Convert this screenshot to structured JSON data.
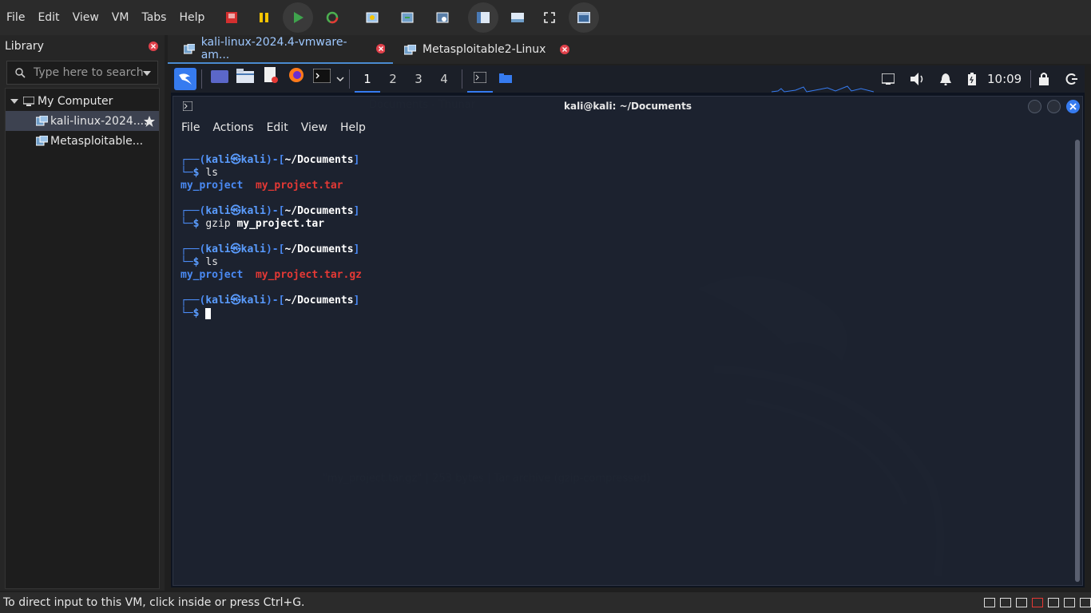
{
  "menubar": {
    "items": [
      "File",
      "Edit",
      "View",
      "VM",
      "Tabs",
      "Help"
    ]
  },
  "library": {
    "title": "Library",
    "search_placeholder": "Type here to search",
    "root": "My Computer",
    "vms": [
      "kali-linux-2024....",
      "Metasploitable..."
    ]
  },
  "tabs": [
    {
      "label": "kali-linux-2024.4-vmware-am..."
    },
    {
      "label": "Metasploitable2-Linux"
    }
  ],
  "guest_panel": {
    "workspaces": [
      "1",
      "2",
      "3",
      "4"
    ],
    "clock": "10:09"
  },
  "terminal": {
    "title": "kali@kali: ~/Documents",
    "menu": [
      "File",
      "Actions",
      "Edit",
      "View",
      "Help"
    ],
    "prompt_user": "kali",
    "prompt_host": "kali",
    "prompt_dir": "~/Documents",
    "lines": {
      "cmd1": "ls",
      "out1_dir": "my_project",
      "out1_file": "my_project.tar",
      "cmd2_prog": "gzip",
      "cmd2_arg": "my_project.tar",
      "cmd3": "ls",
      "out3_dir": "my_project",
      "out3_file": "my_project.tar.gz"
    }
  },
  "statusbar": {
    "text": "To direct input to this VM, click inside or press Ctrl+G."
  },
  "colors": {
    "accent": "#367bf0",
    "prompt_blue": "#4a8af4",
    "archive_red": "#e53935"
  }
}
